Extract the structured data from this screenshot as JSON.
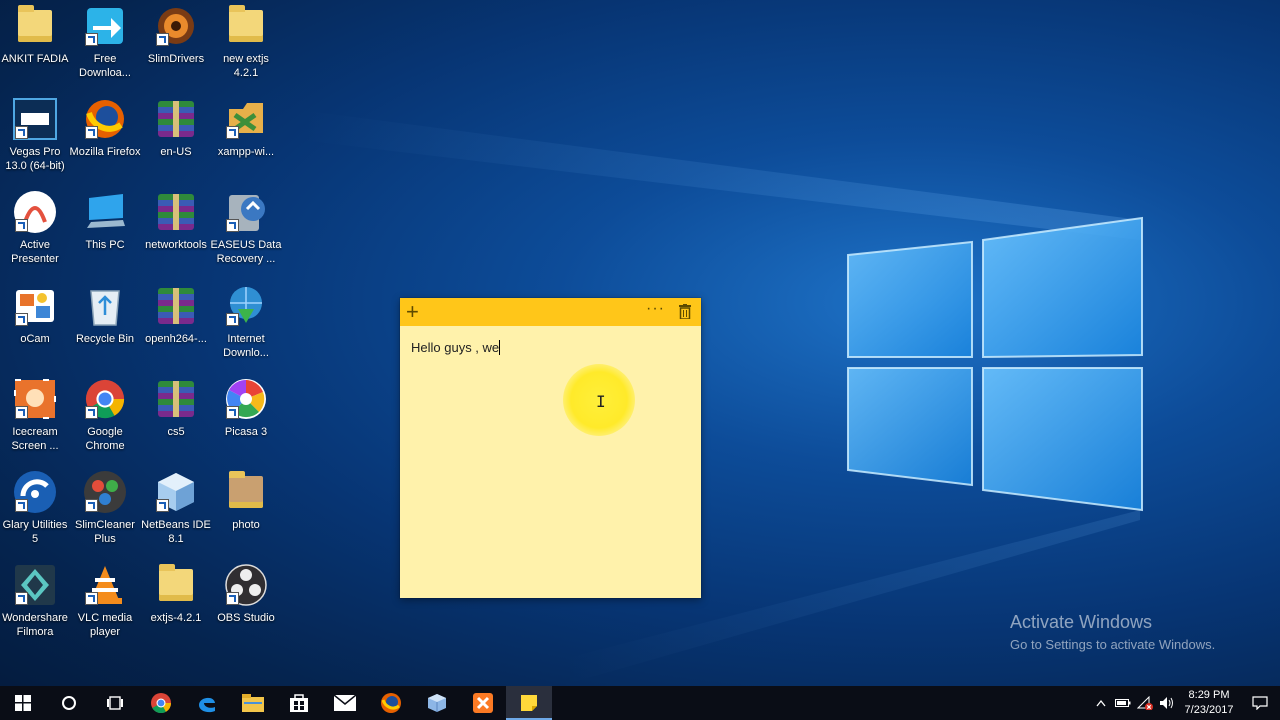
{
  "desktop": {
    "icons": [
      {
        "label": "ANKIT FADIA"
      },
      {
        "label": "Free Downloa..."
      },
      {
        "label": "SlimDrivers"
      },
      {
        "label": "new extjs 4.2.1"
      },
      {
        "label": "Vegas Pro 13.0 (64-bit)"
      },
      {
        "label": "Mozilla Firefox"
      },
      {
        "label": "en-US"
      },
      {
        "label": "xampp-wi..."
      },
      {
        "label": "Active Presenter"
      },
      {
        "label": "This PC"
      },
      {
        "label": "networktools"
      },
      {
        "label": "EASEUS Data Recovery ..."
      },
      {
        "label": "oCam"
      },
      {
        "label": "Recycle Bin"
      },
      {
        "label": "openh264-..."
      },
      {
        "label": "Internet Downlo..."
      },
      {
        "label": "Icecream Screen ..."
      },
      {
        "label": "Google Chrome"
      },
      {
        "label": "cs5"
      },
      {
        "label": "Picasa 3"
      },
      {
        "label": "Glary Utilities 5"
      },
      {
        "label": "SlimCleaner Plus"
      },
      {
        "label": "NetBeans IDE 8.1"
      },
      {
        "label": "photo"
      },
      {
        "label": "Wondershare Filmora"
      },
      {
        "label": "VLC media player"
      },
      {
        "label": "extjs-4.2.1"
      },
      {
        "label": "OBS Studio"
      }
    ]
  },
  "sticky_note": {
    "add_icon": "+",
    "more_icon": "···",
    "text": "Hello guys , we",
    "cursor_glyph": "I",
    "background_color": "#fff2ab",
    "header_color": "#ffc619"
  },
  "watermark": {
    "title": "Activate Windows",
    "subtitle": "Go to Settings to activate Windows."
  },
  "taskbar": {
    "time": "8:29 PM",
    "date": "7/23/2017",
    "pinned": [
      "start-icon",
      "cortana-icon",
      "task-view-icon",
      "chrome-icon",
      "edge-icon",
      "file-explorer-icon",
      "store-icon",
      "mail-icon",
      "firefox-icon",
      "virtualbox-icon",
      "xampp-icon",
      "sticky-notes-icon"
    ]
  }
}
